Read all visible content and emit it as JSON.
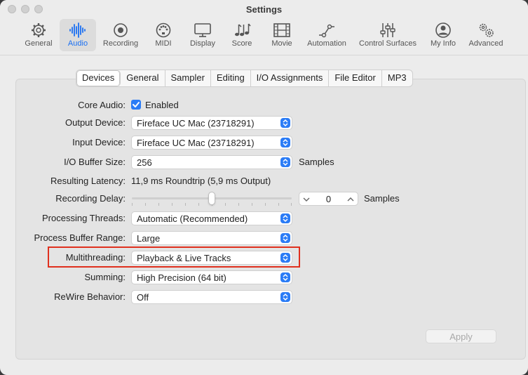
{
  "window": {
    "title": "Settings"
  },
  "toolbar": {
    "items": [
      {
        "label": "General",
        "icon": "gear-icon"
      },
      {
        "label": "Audio",
        "icon": "waveform-icon"
      },
      {
        "label": "Recording",
        "icon": "record-icon"
      },
      {
        "label": "MIDI",
        "icon": "midi-port-icon"
      },
      {
        "label": "Display",
        "icon": "display-icon"
      },
      {
        "label": "Score",
        "icon": "music-notes-icon"
      },
      {
        "label": "Movie",
        "icon": "film-icon"
      },
      {
        "label": "Automation",
        "icon": "automation-curve-icon"
      },
      {
        "label": "Control Surfaces",
        "icon": "faders-icon"
      },
      {
        "label": "My Info",
        "icon": "person-icon"
      },
      {
        "label": "Advanced",
        "icon": "gears-icon"
      }
    ],
    "active": "Audio"
  },
  "tabs": {
    "items": [
      "Devices",
      "General",
      "Sampler",
      "Editing",
      "I/O Assignments",
      "File Editor",
      "MP3"
    ],
    "selected": "Devices"
  },
  "form": {
    "core_audio": {
      "label": "Core Audio:",
      "value": "Enabled",
      "checked": true
    },
    "output_device": {
      "label": "Output Device:",
      "value": "Fireface UC Mac (23718291)"
    },
    "input_device": {
      "label": "Input Device:",
      "value": "Fireface UC Mac (23718291)"
    },
    "io_buffer_size": {
      "label": "I/O Buffer Size:",
      "value": "256",
      "suffix": "Samples"
    },
    "resulting_latency": {
      "label": "Resulting Latency:",
      "value": "11,9 ms Roundtrip (5,9 ms Output)"
    },
    "recording_delay": {
      "label": "Recording Delay:",
      "value": "0",
      "suffix": "Samples"
    },
    "processing_threads": {
      "label": "Processing Threads:",
      "value": "Automatic (Recommended)"
    },
    "process_buffer_range": {
      "label": "Process Buffer Range:",
      "value": "Large"
    },
    "multithreading": {
      "label": "Multithreading:",
      "value": "Playback & Live Tracks"
    },
    "summing": {
      "label": "Summing:",
      "value": "High Precision (64 bit)"
    },
    "rewire_behavior": {
      "label": "ReWire Behavior:",
      "value": "Off"
    }
  },
  "apply_button": {
    "label": "Apply",
    "enabled": false
  },
  "colors": {
    "accent": "#2b7cf6",
    "highlight": "#e0301e"
  }
}
